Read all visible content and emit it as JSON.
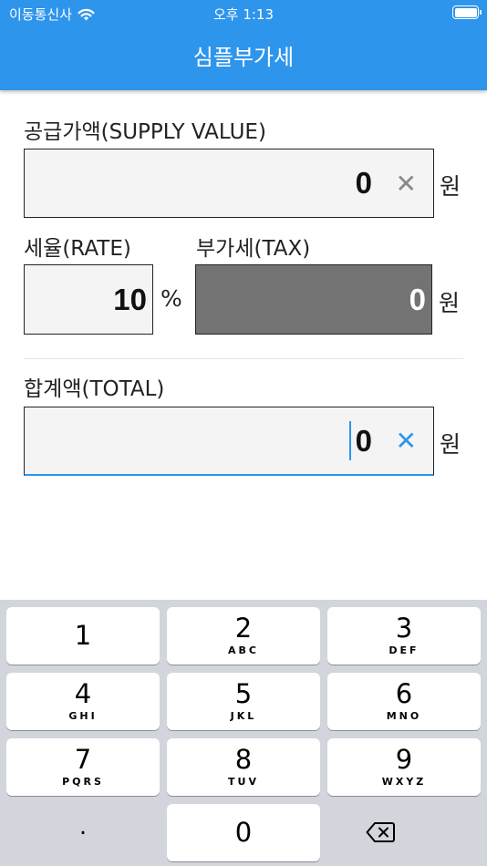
{
  "status_bar": {
    "carrier": "이동통신사",
    "time": "오후 1:13"
  },
  "app_title": "심플부가세",
  "supply": {
    "label": "공급가액(SUPPLY VALUE)",
    "value": "0",
    "unit": "원"
  },
  "rate": {
    "label": "세율(RATE)",
    "value": "10",
    "unit": "%"
  },
  "tax": {
    "label": "부가세(TAX)",
    "value": "0",
    "unit": "원"
  },
  "total": {
    "label": "합계액(TOTAL)",
    "value": "0",
    "unit": "원"
  },
  "keyboard": {
    "keys": [
      {
        "num": "1",
        "sub": ""
      },
      {
        "num": "2",
        "sub": "ABC"
      },
      {
        "num": "3",
        "sub": "DEF"
      },
      {
        "num": "4",
        "sub": "GHI"
      },
      {
        "num": "5",
        "sub": "JKL"
      },
      {
        "num": "6",
        "sub": "MNO"
      },
      {
        "num": "7",
        "sub": "PQRS"
      },
      {
        "num": "8",
        "sub": "TUV"
      },
      {
        "num": "9",
        "sub": "WXYZ"
      },
      {
        "num": ".",
        "sub": ""
      },
      {
        "num": "0",
        "sub": ""
      }
    ]
  },
  "colors": {
    "accent": "#2e95ec",
    "tax_field": "#737373",
    "keyboard_bg": "#d2d5db"
  }
}
